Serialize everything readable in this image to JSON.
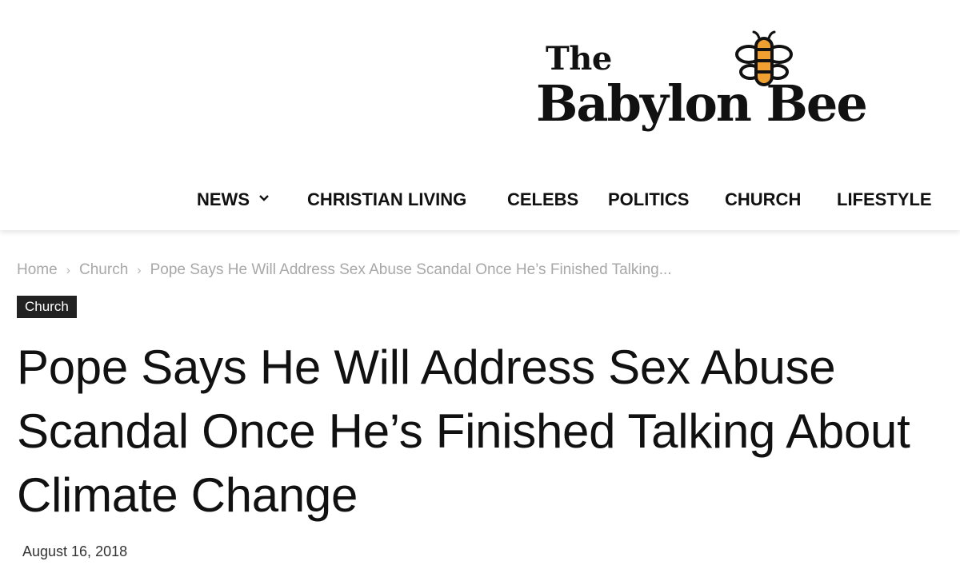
{
  "site": {
    "logo_top": "The",
    "logo_name": "Babylon Bee",
    "logo_icon": "bee-icon",
    "brand_colors": {
      "bee_body": "#f0a030",
      "outline": "#111111"
    }
  },
  "nav": {
    "items": [
      {
        "label": "NEWS",
        "has_dropdown": true,
        "icon": "chevron-down-icon"
      },
      {
        "label": "CHRISTIAN LIVING"
      },
      {
        "label": "CELEBS"
      },
      {
        "label": "POLITICS"
      },
      {
        "label": "CHURCH"
      },
      {
        "label": "LIFESTYLE"
      }
    ]
  },
  "breadcrumb": {
    "items": [
      "Home",
      "Church",
      "Pope Says He Will Address Sex Abuse Scandal Once He’s Finished Talking..."
    ],
    "separator": "›"
  },
  "article": {
    "category": "Church",
    "title": "Pope Says He Will Address Sex Abuse Scandal Once He’s Finished Talking About Climate Change",
    "date": "August 16, 2018"
  }
}
